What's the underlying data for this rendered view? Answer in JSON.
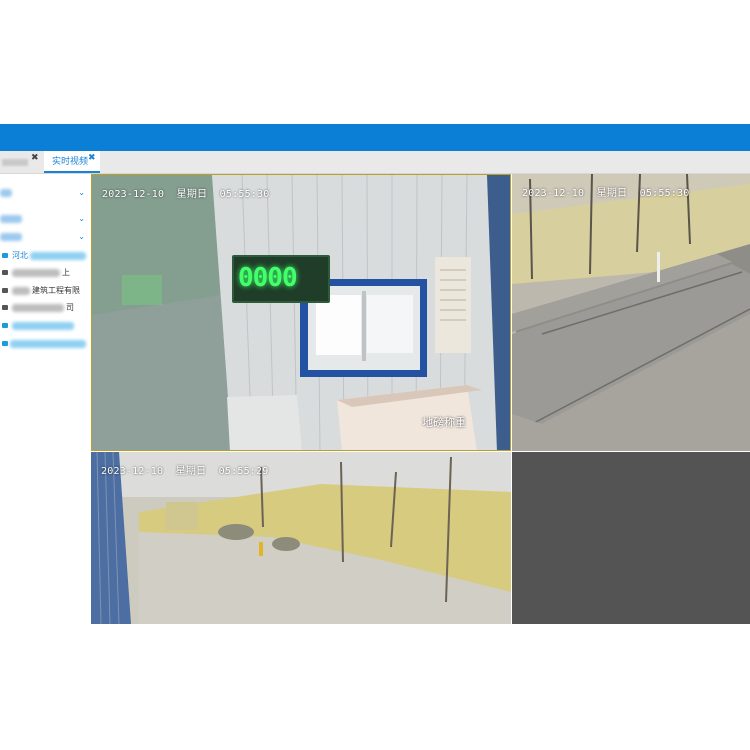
{
  "tabs": [
    {
      "label": "",
      "close": "✖"
    },
    {
      "label": "实时视频",
      "close": "✖"
    }
  ],
  "sidebar": {
    "items": [
      {
        "text": "",
        "chev": "⌄"
      },
      {
        "text": "",
        "chev": "⌄"
      },
      {
        "text": "",
        "chev": "⌄"
      },
      {
        "text": "河北",
        "icon": "camera-icon"
      },
      {
        "text": "上",
        "icon": "camera-icon"
      },
      {
        "text": "建筑工程有限",
        "icon": "camera-icon"
      },
      {
        "text": "司",
        "icon": "camera-icon"
      },
      {
        "text": "",
        "icon": "camera-icon"
      },
      {
        "text": "",
        "icon": "camera-icon"
      }
    ]
  },
  "videos": [
    {
      "timestamp": "2023-12-10  星期日  05:55:30",
      "caption": "地磅称重",
      "scale_reading": "0000"
    },
    {
      "timestamp": "2023-12-10  星期日  05:55:30"
    },
    {
      "timestamp": "2023-12-10  星期日  05:55:29"
    }
  ],
  "colors": {
    "header": "#0b7fd6",
    "accent": "#1a83d6",
    "empty_cell": "#545454"
  }
}
